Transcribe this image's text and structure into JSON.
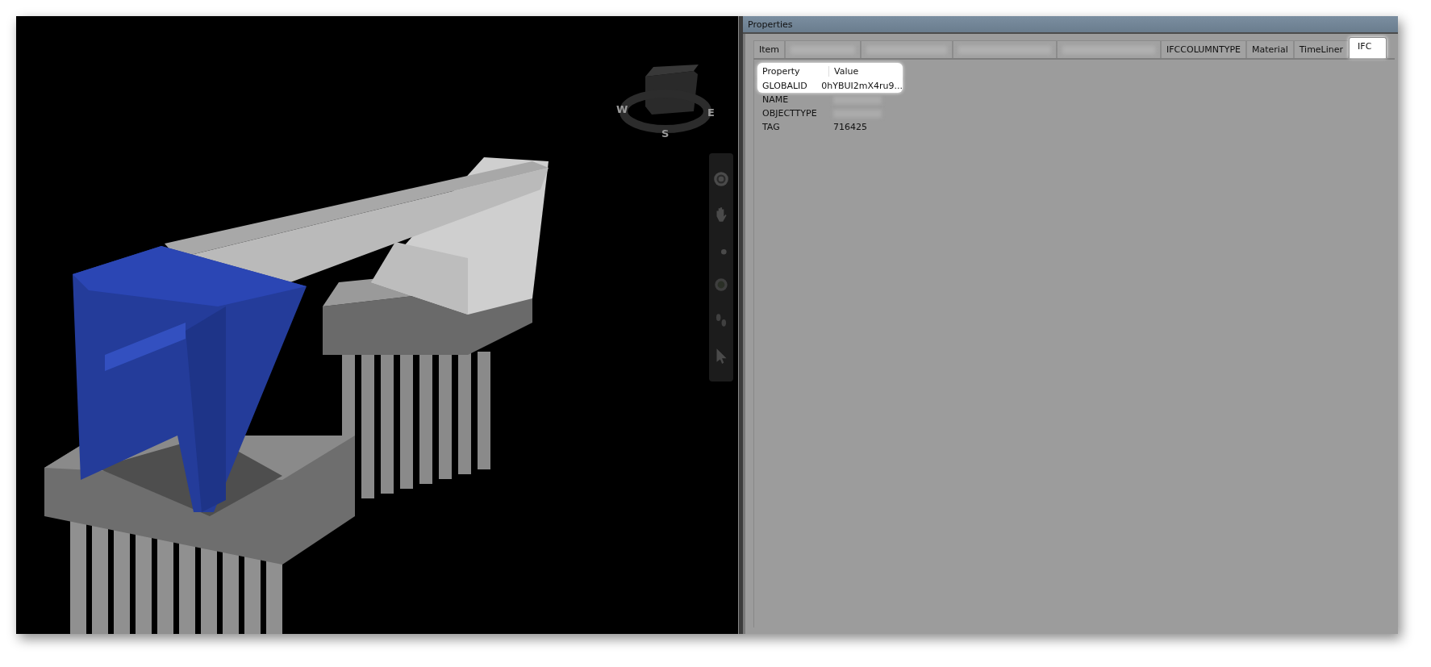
{
  "viewport": {
    "compass": {
      "labels": [
        "W",
        "S",
        "E"
      ]
    }
  },
  "properties": {
    "title": "Properties",
    "tabs": [
      {
        "kind": "text",
        "label": "Item",
        "selected": false
      },
      {
        "kind": "redacted",
        "selected": false
      },
      {
        "kind": "redacted",
        "selected": false
      },
      {
        "kind": "redacted",
        "selected": false
      },
      {
        "kind": "redacted",
        "selected": false
      },
      {
        "kind": "text",
        "label": "IFCCOLUMNTYPE",
        "selected": false
      },
      {
        "kind": "text",
        "label": "Material",
        "selected": false
      },
      {
        "kind": "text",
        "label": "TimeLiner",
        "selected": false
      },
      {
        "kind": "text",
        "label": "IFC",
        "selected": true
      }
    ],
    "table": {
      "columns": [
        "Property",
        "Value"
      ],
      "rows": [
        {
          "property": "GLOBALID",
          "kind": "text",
          "value": "0hYBUI2mX4ru9...",
          "highlighted": true
        },
        {
          "property": "NAME",
          "kind": "redacted",
          "highlighted": false
        },
        {
          "property": "OBJECTTYPE",
          "kind": "redacted",
          "highlighted": false
        },
        {
          "property": "TAG",
          "kind": "text",
          "value": "716425",
          "highlighted": false
        }
      ]
    }
  }
}
